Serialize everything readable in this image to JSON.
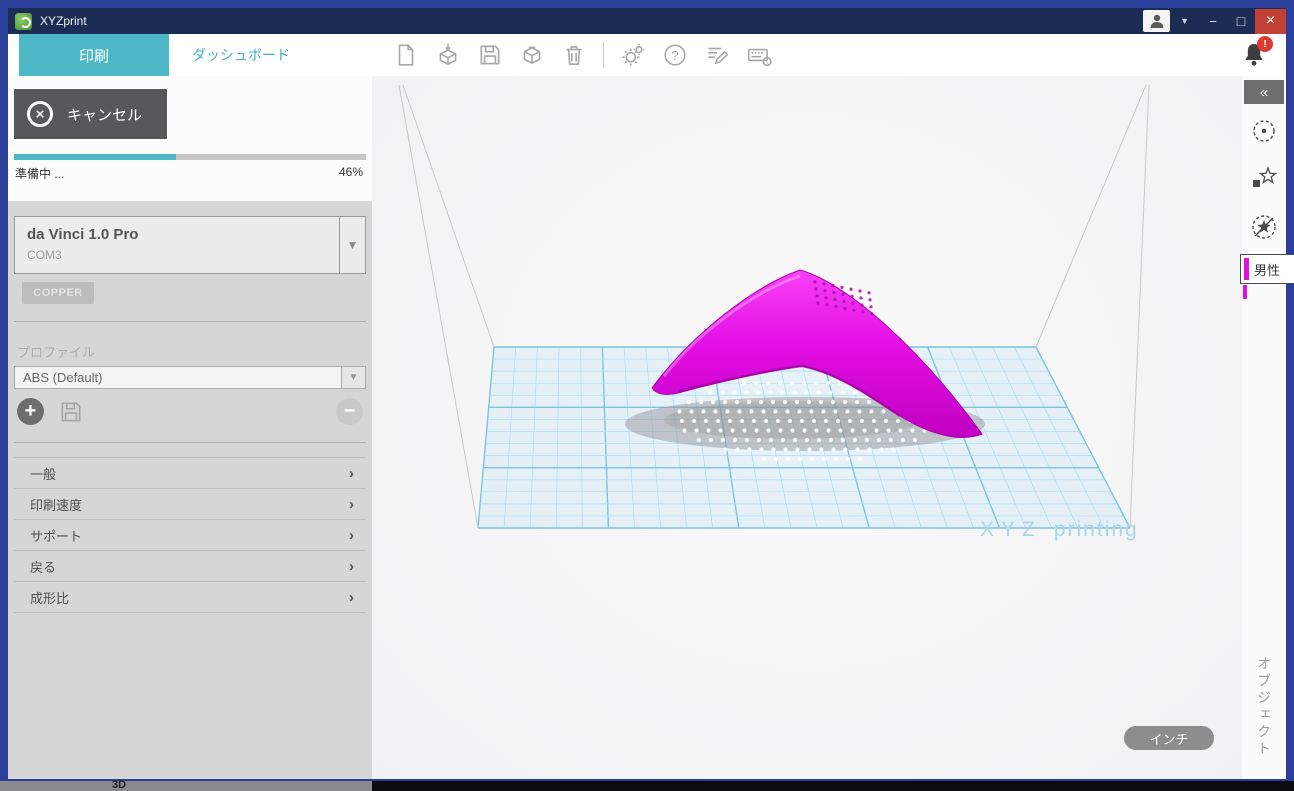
{
  "titlebar": {
    "app_title": "XYZprint"
  },
  "tabs": {
    "print": "印刷",
    "dashboard": "ダッシュボード"
  },
  "toolbar": {
    "icons": [
      "new-file-icon",
      "import-model-icon",
      "save-icon",
      "export-model-icon",
      "delete-icon",
      "settings-gears-icon",
      "help-icon",
      "edit-note-icon",
      "keyboard-info-icon"
    ]
  },
  "notification": {
    "badge": "!"
  },
  "job": {
    "cancel": "キャンセル",
    "status": "準備中 ...",
    "percent": "46%",
    "progress_value": 46
  },
  "printer": {
    "name": "da Vinci 1.0 Pro",
    "port": "COM3",
    "material_tag": "COPPER"
  },
  "profile": {
    "label": "プロファイル",
    "value": "ABS (Default)"
  },
  "menu": {
    "general": "一般",
    "speed": "印刷速度",
    "support": "サポート",
    "back": "戻る",
    "ratio": "成形比"
  },
  "viewport": {
    "brand_xyz": "XYZ",
    "brand_printing": "printing",
    "units": "インチ"
  },
  "objects": {
    "item": "男性",
    "panel_title": "オブジェクト"
  },
  "bottom": {
    "taskbar_item": "3D"
  },
  "colors": {
    "accent": "#4fb8c6",
    "model": "#e30ee3",
    "close": "#c14234",
    "grid": "#9fd4ea",
    "titlebar": "#1b2c55"
  }
}
